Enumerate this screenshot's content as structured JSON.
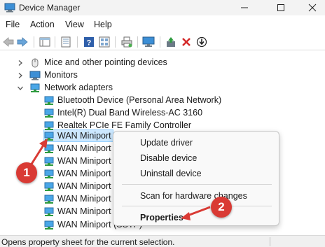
{
  "window": {
    "title": "Device Manager"
  },
  "menu": [
    "File",
    "Action",
    "View",
    "Help"
  ],
  "tree": {
    "categories": {
      "mice": "Mice and other pointing devices",
      "monitors": "Monitors",
      "network": "Network adapters"
    },
    "network_items": [
      "Bluetooth Device (Personal Area Network)",
      "Intel(R) Dual Band Wireless-AC 3160",
      "Realtek PCIe FE Family Controller",
      "WAN Miniport",
      "WAN Miniport",
      "WAN Miniport",
      "WAN Miniport",
      "WAN Miniport",
      "WAN Miniport",
      "WAN Miniport",
      "WAN Miniport (SSTP)"
    ],
    "selected_index": 3
  },
  "context_menu": {
    "items": [
      "Update driver",
      "Disable device",
      "Uninstall device",
      "Scan for hardware changes",
      "Properties"
    ],
    "bold_item": "Properties"
  },
  "callouts": {
    "one": "1",
    "two": "2"
  },
  "status": {
    "text": "Opens property sheet for the current selection."
  },
  "colors": {
    "selection": "#cce8ff",
    "callout": "#d93a34",
    "titlebar": "#f3f3f3"
  }
}
